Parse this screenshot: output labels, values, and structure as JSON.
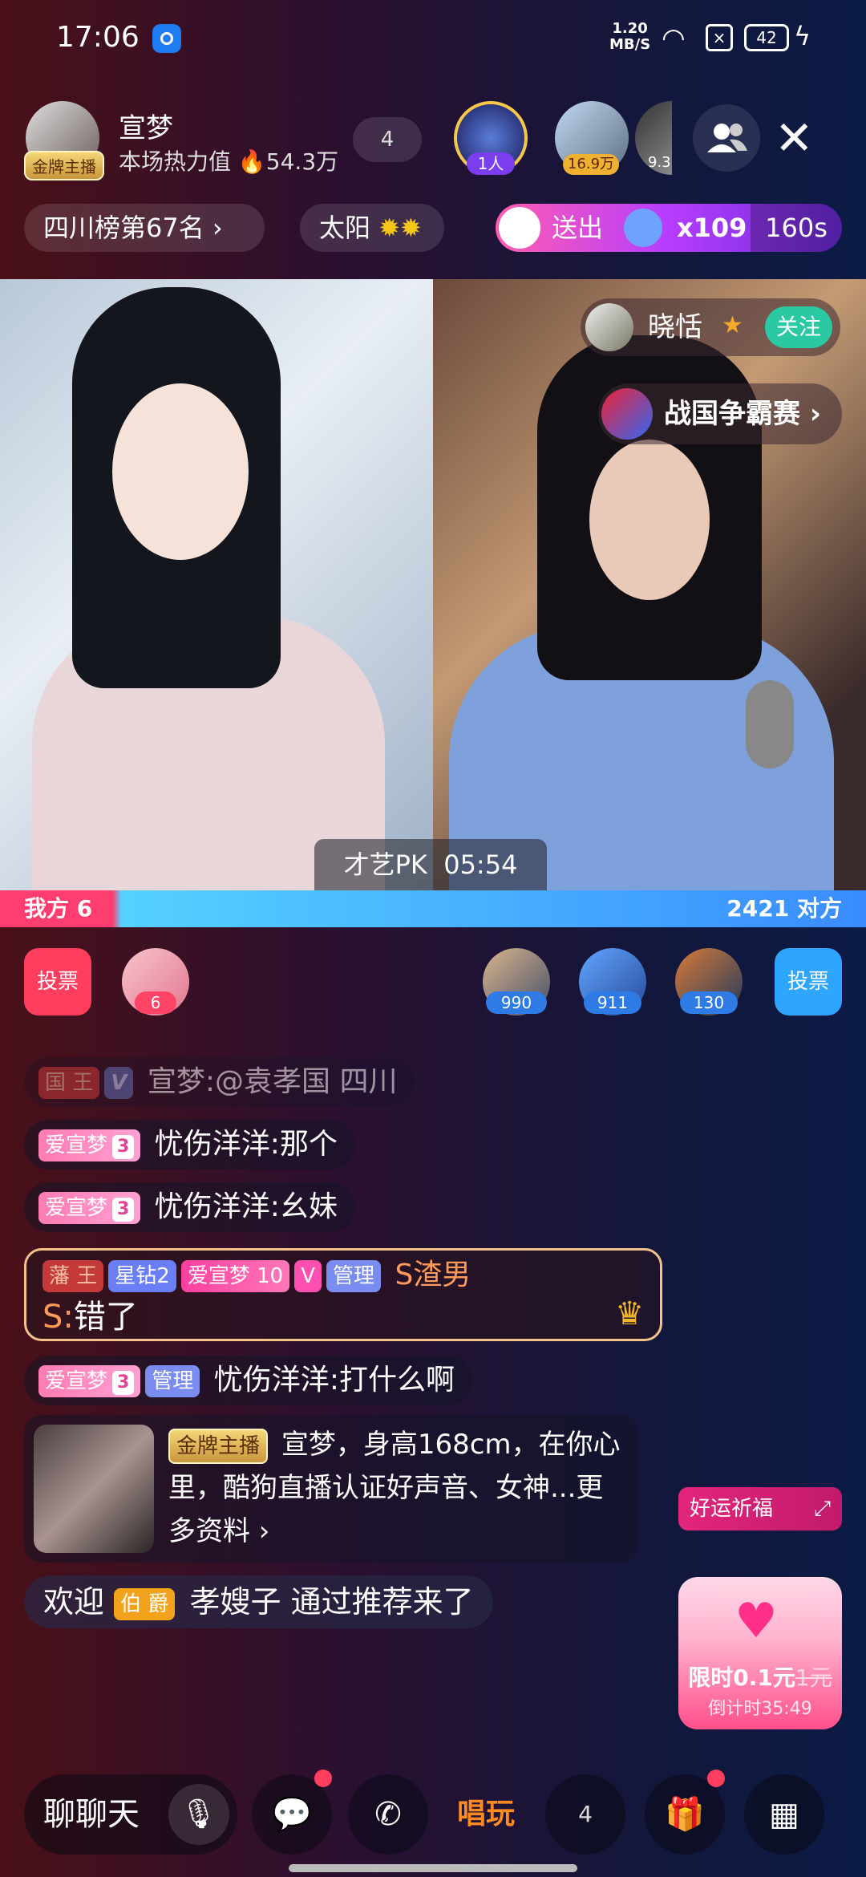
{
  "status_bar": {
    "time": "17:06",
    "net_speed_top": "1.20",
    "net_speed_bottom": "MB/S",
    "battery": "42"
  },
  "header": {
    "streamer_name": "宣梦",
    "badge": "金牌主播",
    "heat_label": "本场热力值",
    "heat_value": "54.3万",
    "heart_count": "4",
    "top_viewers": [
      {
        "tag": "1人"
      },
      {
        "tag": "16.9万"
      },
      {
        "tag": "9.3"
      }
    ],
    "rank_chip": "四川榜第67名",
    "level_chip": "太阳",
    "gift_banner": {
      "label": "送出",
      "count": "x109",
      "timer": "160s"
    }
  },
  "pk": {
    "opponent_name": "晓恬",
    "follow_label": "关注",
    "game_label": "战国争霸赛",
    "timer_label": "才艺PK",
    "timer_value": "05:54",
    "our_label": "我方",
    "our_score": "6",
    "their_score": "2421",
    "their_label": "对方",
    "vote_label": "投票",
    "our_supporters": [
      {
        "count": "6"
      }
    ],
    "their_supporters": [
      {
        "count": "990"
      },
      {
        "count": "911"
      },
      {
        "count": "130"
      }
    ]
  },
  "chat": [
    {
      "tags": [
        "国 王",
        "V"
      ],
      "user": "宣梦",
      "text": "@袁孝国 四川"
    },
    {
      "fan_tag": "爱宣梦",
      "fan_level": "3",
      "user": "忧伤洋洋",
      "text": "那个"
    },
    {
      "fan_tag": "爱宣梦",
      "fan_level": "3",
      "user": "忧伤洋洋",
      "text": "幺妹"
    }
  ],
  "special_msg": {
    "noble": "藩 王",
    "diamond": "星钻2",
    "fan_tag": "爱宣梦",
    "fan_level": "10",
    "vip": "V",
    "admin": "管理",
    "user_line1": "S渣男",
    "user_line2": "S",
    "text": "错了"
  },
  "chat2": {
    "fan_tag": "爱宣梦",
    "fan_level": "3",
    "admin": "管理",
    "user": "忧伤洋洋",
    "text": "打什么啊"
  },
  "profile_card": {
    "badge": "金牌主播",
    "text": "宣梦，身高168cm，在你心里，酷狗直播认证好声音、女神...更多资料 ›"
  },
  "welcome": {
    "prefix": "欢迎",
    "noble": "伯 爵",
    "user": "孝嫂子",
    "suffix": "通过推荐来了"
  },
  "bless_button": "好运祈福",
  "promo": {
    "price_prefix": "限时0.1元",
    "orig_price": "1元",
    "countdown": "倒计时35:49"
  },
  "bottom_bar": {
    "chat_placeholder": "聊聊天",
    "sing_label": "唱玩",
    "heart_count": "4"
  }
}
